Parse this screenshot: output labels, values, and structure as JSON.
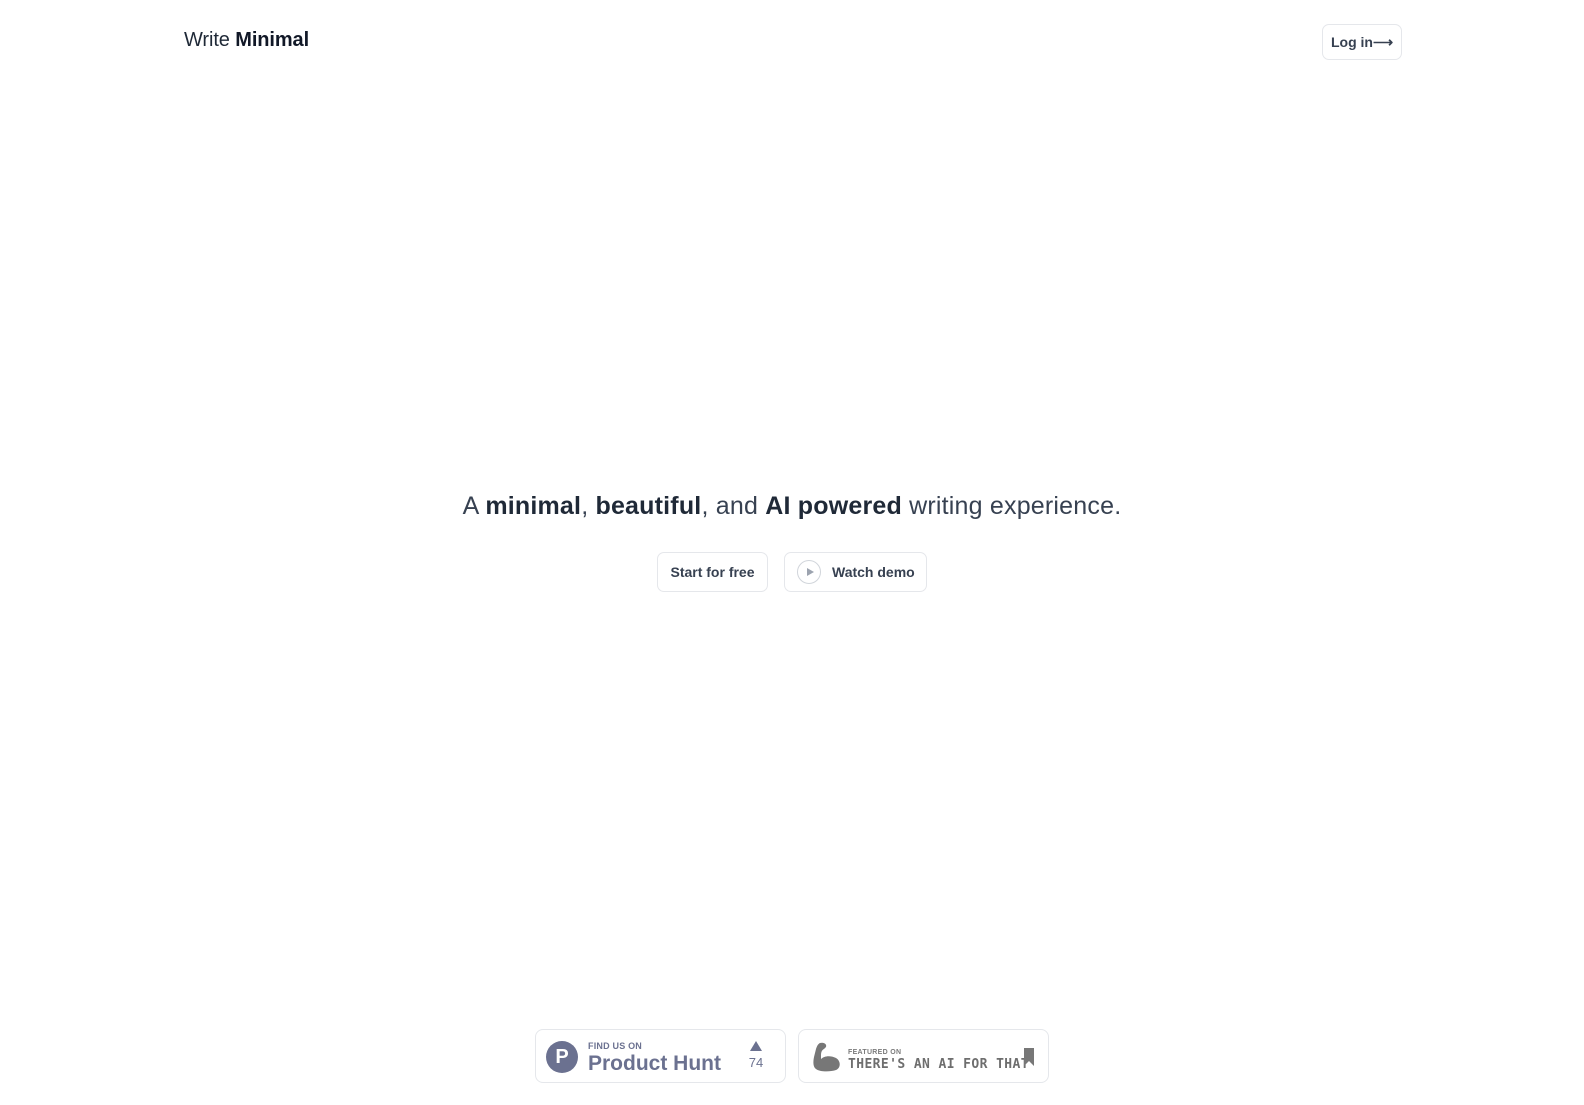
{
  "header": {
    "logo_light": "Write",
    "logo_bold": "Minimal",
    "login_label": "Log in⟶"
  },
  "hero": {
    "tagline_parts": [
      {
        "text": "A ",
        "bold": false
      },
      {
        "text": "minimal",
        "bold": true
      },
      {
        "text": ", ",
        "bold": false
      },
      {
        "text": "beautiful",
        "bold": true
      },
      {
        "text": ", and ",
        "bold": false
      },
      {
        "text": "AI powered",
        "bold": true
      },
      {
        "text": " writing experience.",
        "bold": false
      }
    ],
    "start_label": "Start for free",
    "demo_label": "Watch demo",
    "demo_icon": "play-icon"
  },
  "badges": {
    "product_hunt": {
      "logo_letter": "P",
      "small_text": "FIND US ON",
      "name": "Product Hunt",
      "upvote_icon": "triangle-up-icon",
      "votes": "74",
      "color": "#6b7190"
    },
    "taaft": {
      "icon": "flexed-arm-icon",
      "small_text": "FEATURED ON",
      "name": "THERE'S AN AI FOR THAT",
      "bookmark_icon": "bookmark-icon",
      "color": "#6e6e6e"
    }
  }
}
